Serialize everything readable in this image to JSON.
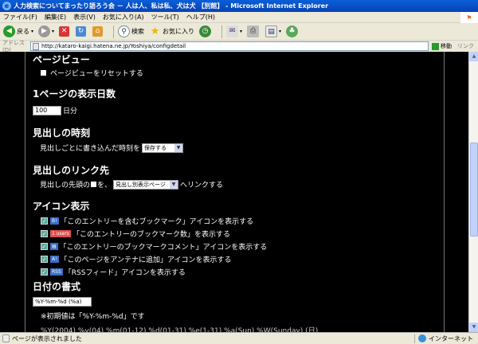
{
  "window": {
    "title": "人力検索についてまったり語ろう会 － 人は人、私は私、犬は犬 【別館】 - Microsoft Internet Explorer",
    "icon": "ie-icon"
  },
  "menu": [
    "ファイル(F)",
    "編集(E)",
    "表示(V)",
    "お気に入り(A)",
    "ツール(T)",
    "ヘルプ(H)"
  ],
  "toolbar": {
    "back": "戻る",
    "search": "検索",
    "favorites": "お気に入り"
  },
  "address": {
    "label": "アドレス(D)",
    "url": "http://kataro-kaigi.hatena.ne.jp/Yoshiya/configdetail",
    "go": "移動",
    "links": "リンク"
  },
  "page": {
    "pageview": {
      "heading": "ページビュー",
      "reset_label": "ページビューをリセットする"
    },
    "days": {
      "heading": "1ページの表示日数",
      "value": "100",
      "unit": "日分"
    },
    "time": {
      "heading": "見出しの時刻",
      "prefix": "見出しごとに書き込んだ時刻を",
      "select": "保存する"
    },
    "link": {
      "heading": "見出しのリンク先",
      "prefix": "見出しの先頭の",
      "mid": "を、",
      "select": "見出し別表示ページ",
      "suffix": "へリンクする"
    },
    "icons": {
      "heading": "アイコン表示",
      "items": [
        {
          "tag": "B!",
          "tag_color": "#3a6ec8",
          "label": "「このエントリーを含むブックマーク」アイコンを表示する"
        },
        {
          "tag": "1 users",
          "tag_color": "#e05050",
          "label": "「このエントリーのブックマーク数」を表示する"
        },
        {
          "tag": "▤",
          "tag_color": "#3a6ec8",
          "label": "「このエントリーのブックマークコメント」アイコンを表示する"
        },
        {
          "tag": "A!",
          "tag_color": "#3a6ec8",
          "label": "「このページをアンテナに追加」アイコンを表示する"
        },
        {
          "tag": "RSS",
          "tag_color": "#3a6ec8",
          "label": "「RSSフィード」アイコンを表示する"
        }
      ]
    },
    "date": {
      "heading": "日付の書式",
      "value": "%Y-%m-%d (%a)",
      "note": "※初期値は「%Y-%m-%d」です",
      "cut": "%Y(2004) %y(04) %m(01-12) %d(01-31) %e(1-31) %a(Sun) %W(Sunday) (日)"
    }
  },
  "status": {
    "message": "ページが表示されました",
    "zone": "インターネット"
  }
}
